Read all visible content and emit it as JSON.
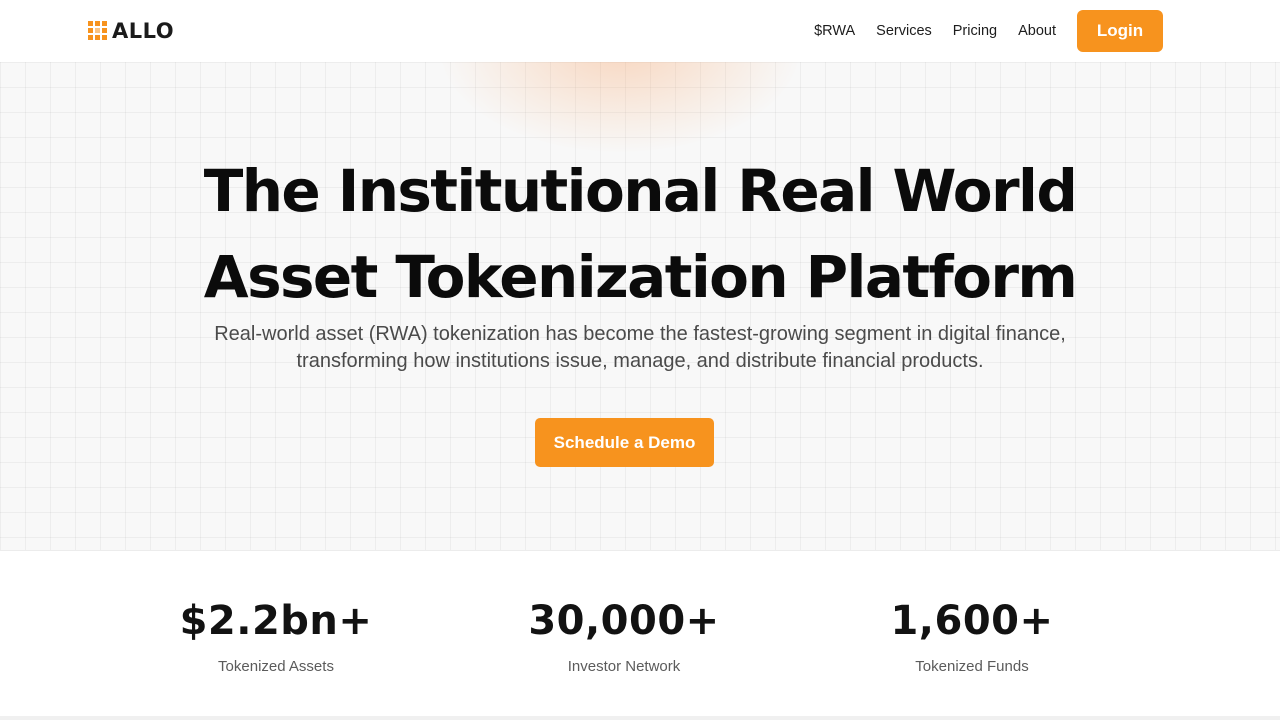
{
  "brand": {
    "name": "ALLO",
    "accent_color": "#f7931e",
    "logo_icon": "grid-blocks-icon"
  },
  "nav": {
    "links": [
      "$RWA",
      "Services",
      "Pricing",
      "About"
    ],
    "login_label": "Login"
  },
  "hero": {
    "title_line1": "The Institutional Real World",
    "title_line2": "Asset Tokenization Platform",
    "subtitle_line1": "Real-world asset (RWA) tokenization has become the fastest-growing segment in digital finance,",
    "subtitle_line2": "transforming how institutions issue, manage, and distribute financial products.",
    "cta_label": "Schedule a Demo"
  },
  "stats": [
    {
      "value": "$2.2bn+",
      "label": "Tokenized Assets"
    },
    {
      "value": "30,000+",
      "label": "Investor Network"
    },
    {
      "value": "1,600+",
      "label": "Tokenized Funds"
    }
  ]
}
